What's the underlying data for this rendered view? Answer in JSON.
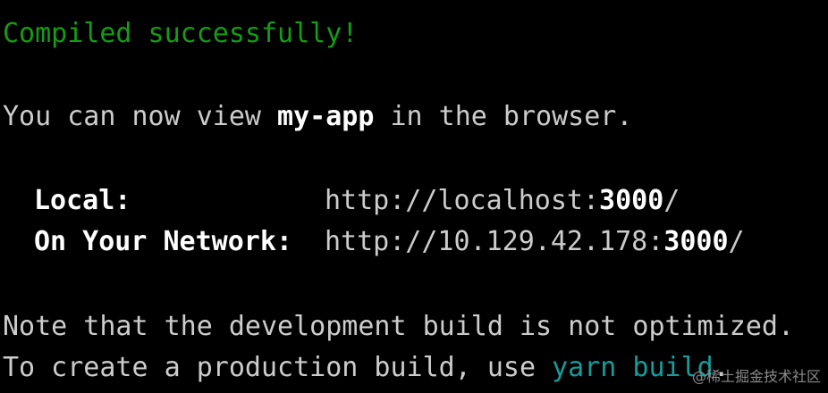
{
  "terminal": {
    "compiled_message": "Compiled successfully!",
    "view_prefix": "You can now view ",
    "app_name": "my-app",
    "view_suffix": " in the browser.",
    "local": {
      "label": "Local:",
      "url_prefix": "http://localhost:",
      "port": "3000",
      "url_suffix": "/"
    },
    "network": {
      "label": "On Your Network:",
      "url_prefix": "http://10.129.42.178:",
      "port": "3000",
      "url_suffix": "/"
    },
    "note_line": "Note that the development build is not optimized.",
    "build_prefix": "To create a production build, use ",
    "build_command": "yarn build",
    "build_suffix": "."
  },
  "watermark": "@稀土掘金技术社区",
  "colors": {
    "background": "#000000",
    "text": "#cccccc",
    "success": "#149c14",
    "highlight": "#ffffff",
    "command": "#179b9b"
  }
}
